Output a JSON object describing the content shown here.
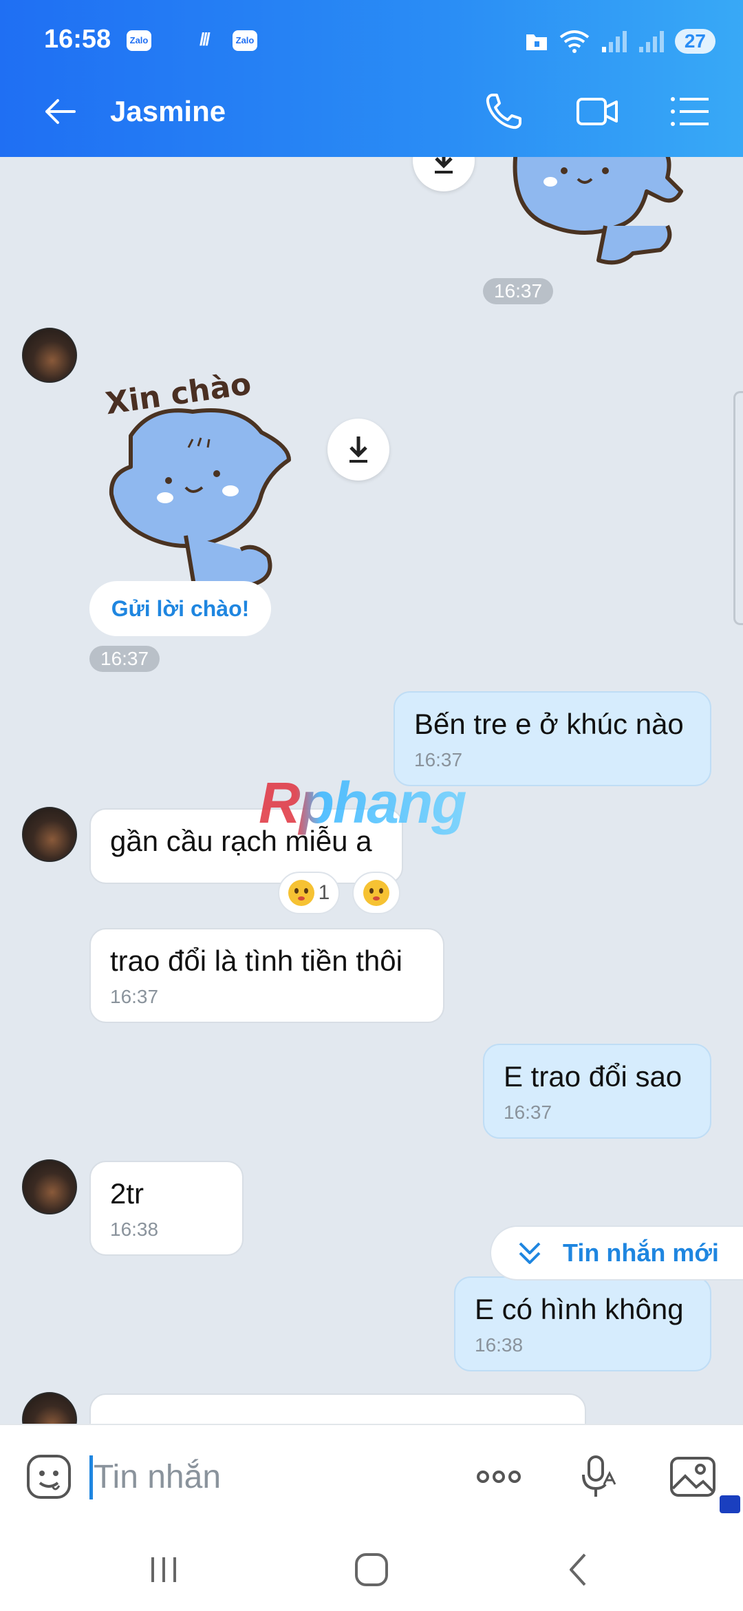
{
  "status_bar": {
    "time": "16:58",
    "app_badge_1": "Zalo",
    "app_badge_2": "Zalo",
    "battery": "27"
  },
  "header": {
    "title": "Jasmine",
    "icons": [
      "back-arrow-icon",
      "phone-icon",
      "video-call-icon",
      "menu-list-icon"
    ]
  },
  "messages": {
    "time_sticker_out": "16:37",
    "greeting_button": "Gửi lời chào!",
    "time_sticker_in": "16:37",
    "m1": {
      "text": "Bến tre e ở khúc nào",
      "time": "16:37"
    },
    "m2": {
      "text": "gần cầu rạch miễu a",
      "reaction_count": "1"
    },
    "m3": {
      "text": "trao đổi là tình tiền thôi",
      "time": "16:37"
    },
    "m4": {
      "text": "E trao đổi sao",
      "time": "16:37"
    },
    "m5": {
      "text": "2tr",
      "time": "16:38"
    },
    "m6": {
      "text": "E có hình không",
      "time": "16:38"
    }
  },
  "sticker": {
    "text": "Xin chào"
  },
  "watermark": "Rphang",
  "new_messages": {
    "label": "Tin nhắn mới"
  },
  "input": {
    "placeholder": "Tin nhắn"
  },
  "colors": {
    "header_start": "#1f6ff3",
    "header_end": "#38a9f6",
    "accent": "#1f86e0",
    "outgoing_bubble": "#d6ecfd",
    "chat_bg": "#e2e8ef"
  }
}
